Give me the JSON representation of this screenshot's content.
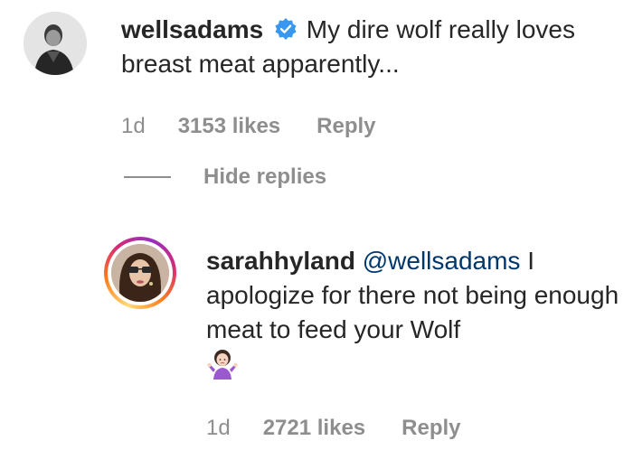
{
  "comments": [
    {
      "username": "wellsadams",
      "verified": true,
      "text": "My dire wolf really loves breast meat apparently...",
      "timestamp": "1d",
      "likes": "3153 likes",
      "reply_label": "Reply"
    },
    {
      "username": "sarahhyland",
      "mention": "@wellsadams",
      "text": "I apologize for there not being enough meat to feed your Wolf",
      "emoji": "person-shrugging-emoji",
      "timestamp": "1d",
      "likes": "2721 likes",
      "reply_label": "Reply"
    }
  ],
  "replies_toggle": {
    "label": "Hide replies"
  },
  "colors": {
    "text": "#262626",
    "secondary": "#8e8e8e",
    "verified": "#3897f0",
    "mention": "#00376b",
    "story_ring": [
      "#feda75",
      "#fa7e1e",
      "#d62976",
      "#962fbf"
    ]
  }
}
